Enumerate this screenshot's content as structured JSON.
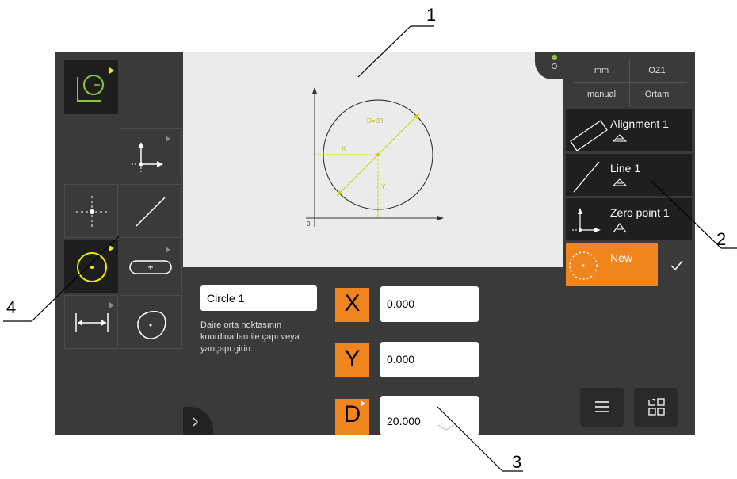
{
  "callouts": [
    "1",
    "2",
    "3",
    "4"
  ],
  "preview": {
    "dim_label": "D=2R",
    "x_label": "X",
    "y_label": "Y",
    "origin_label": "0"
  },
  "editor": {
    "name_value": "Circle 1",
    "hint": "Daire orta noktasının koordinatları ile çapı veya yarıçapı girin.",
    "axes": [
      {
        "label": "X",
        "value": "0.000"
      },
      {
        "label": "Y",
        "value": "0.000"
      },
      {
        "label": "D",
        "value": "20.000"
      }
    ]
  },
  "header": {
    "unit": "mm",
    "coord_system": "OZ1",
    "mode": "manual",
    "average": "Ortam"
  },
  "features": [
    {
      "name": "Alignment 1",
      "icon": "alignment-icon"
    },
    {
      "name": "Line 1",
      "icon": "line-icon"
    },
    {
      "name": "Zero point 1",
      "icon": "zero-point-icon"
    }
  ],
  "new_feature": {
    "label": "New",
    "icon": "dotted-circle-icon"
  },
  "colors": {
    "accent": "#f1851d",
    "highlight": "#e8f000",
    "screen_bg": "#3a3a3a",
    "panel_dark": "#1f1f1f",
    "preview_bg": "#ebebeb"
  }
}
